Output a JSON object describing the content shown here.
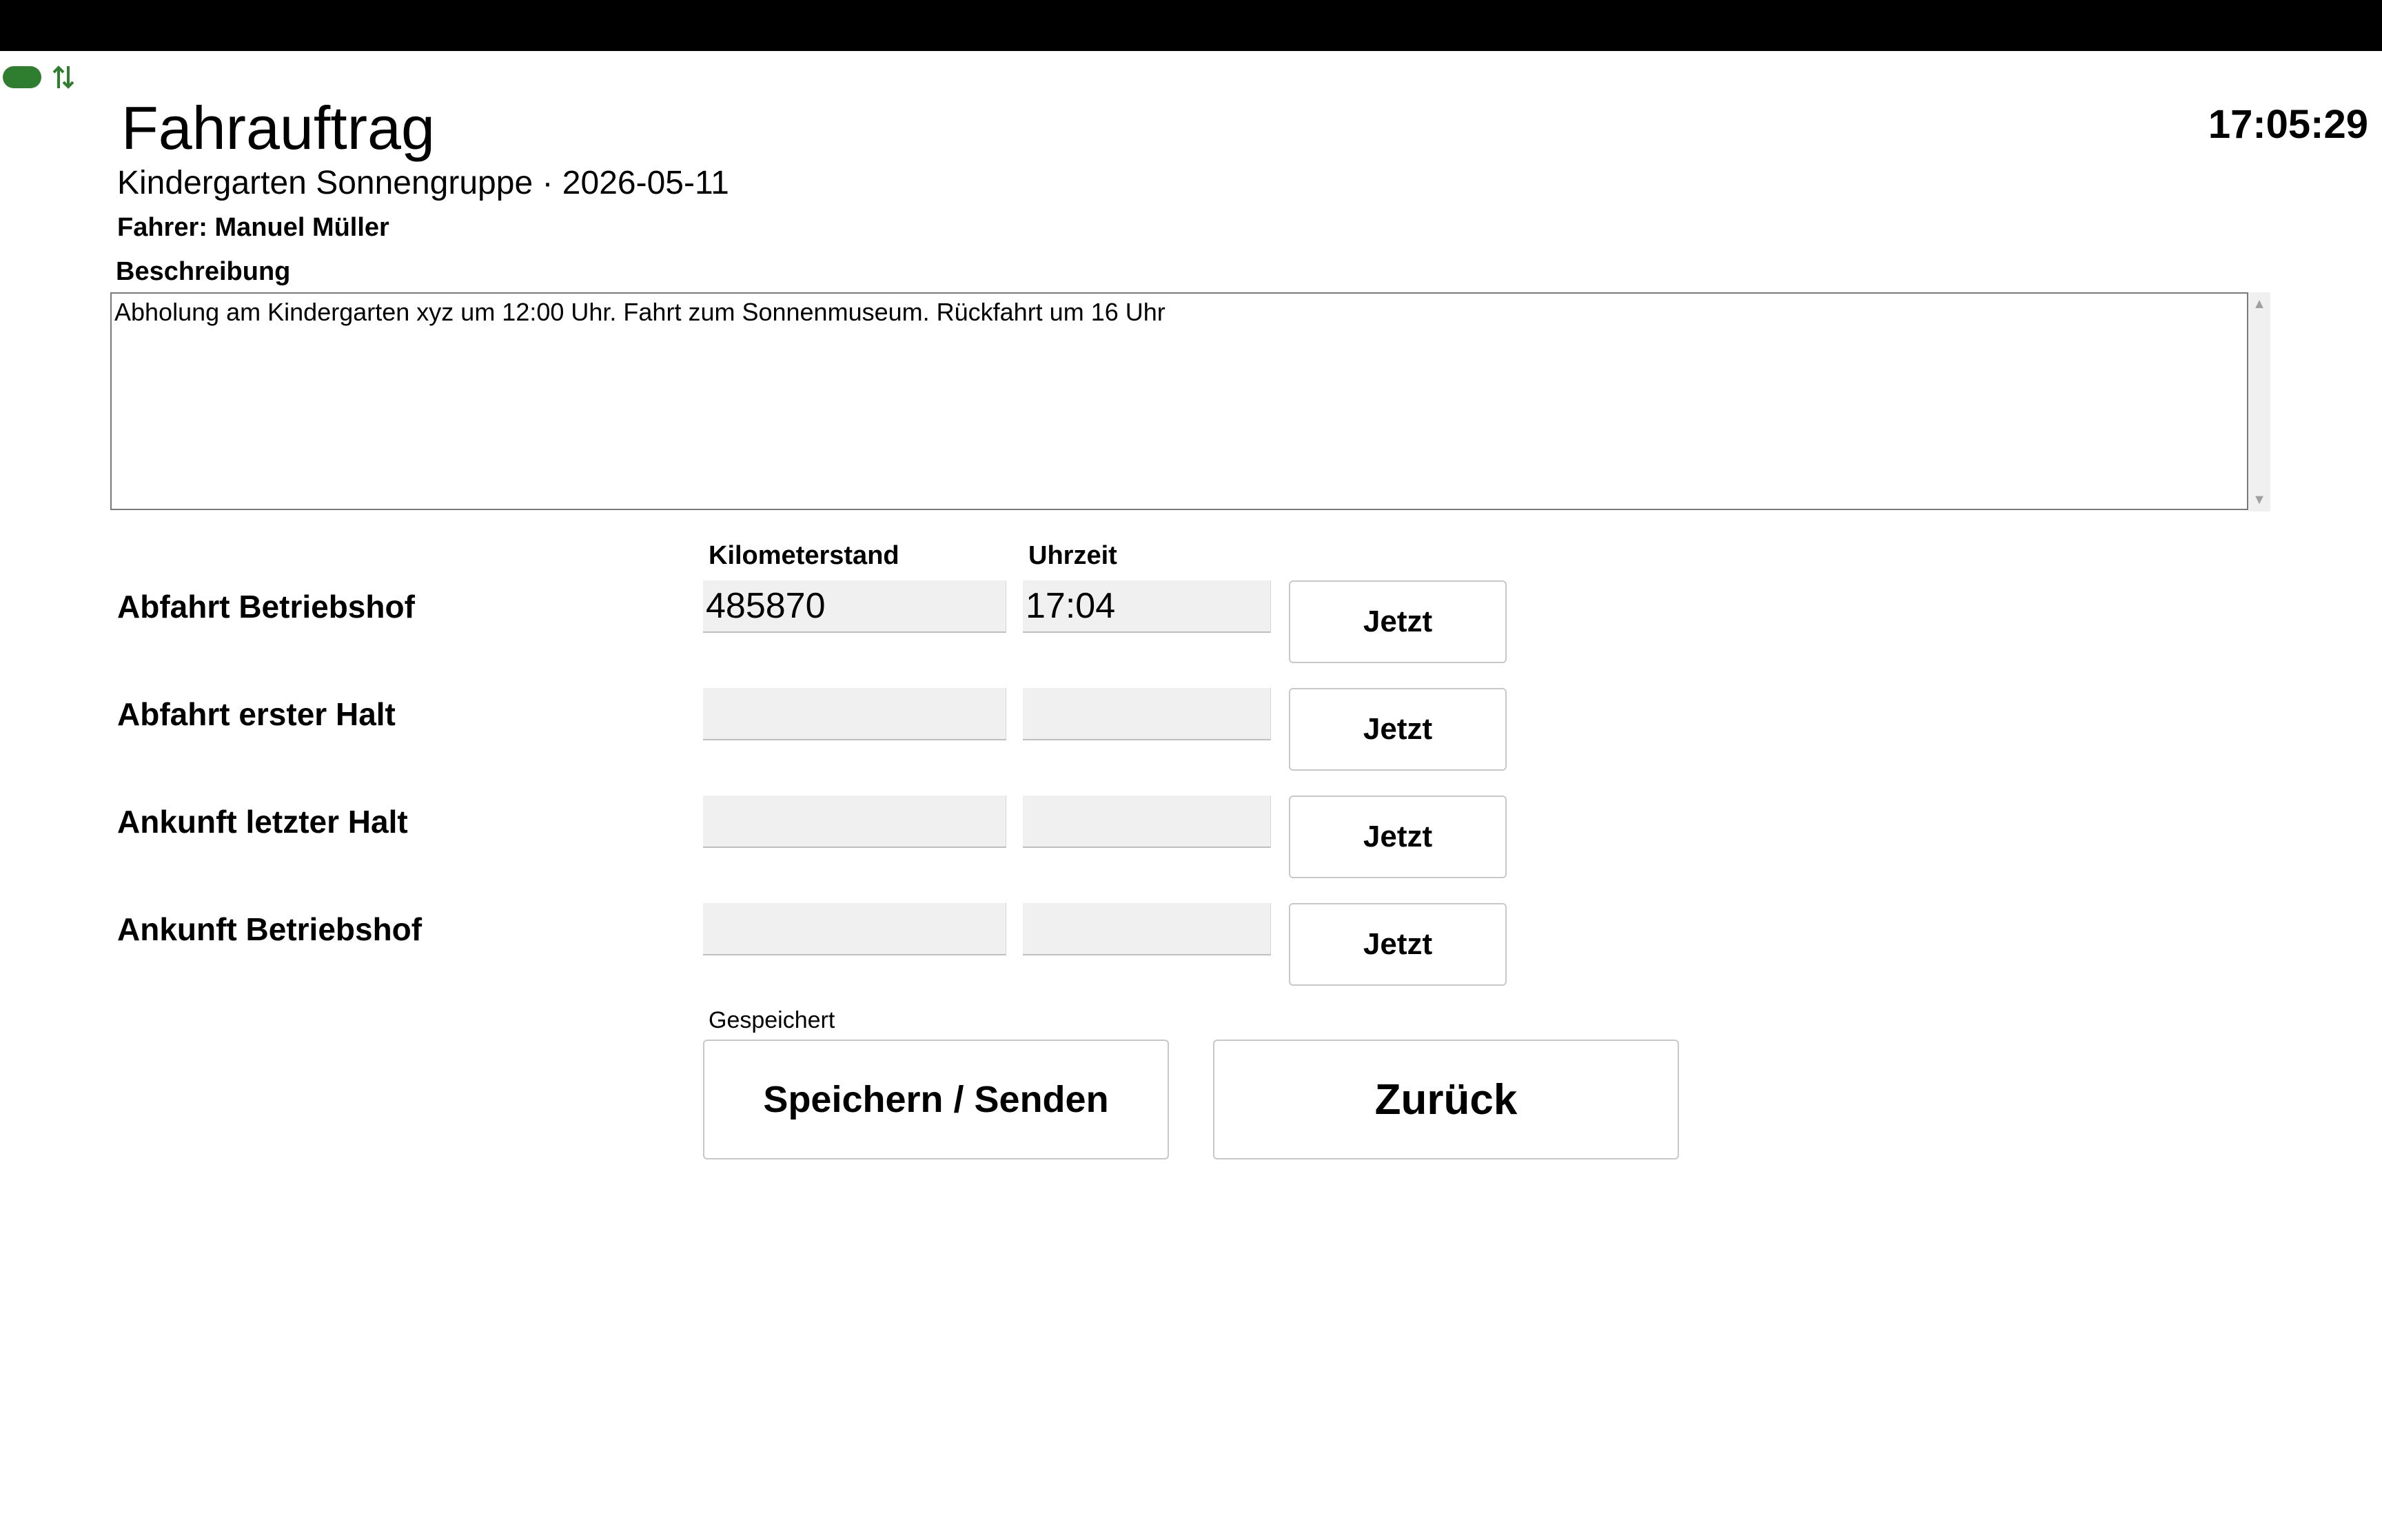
{
  "header": {
    "title": "Fahrauftrag",
    "clock": "17:05:29",
    "subtitle": "Kindergarten Sonnengruppe · 2026-05-11",
    "driver": "Fahrer: Manuel Müller",
    "status_icons": [
      "cloud-icon",
      "sync-arrows-icon"
    ],
    "status_color": "#2f7d2f"
  },
  "description": {
    "label": "Beschreibung",
    "value": "Abholung am Kindergarten xyz um 12:00 Uhr. Fahrt zum Sonnenmuseum. Rückfahrt um 16 Uhr"
  },
  "columns": {
    "km": "Kilometerstand",
    "time": "Uhrzeit"
  },
  "rows": [
    {
      "label": "Abfahrt Betriebshof",
      "km": "485870",
      "time": "17:04",
      "button": "Jetzt"
    },
    {
      "label": "Abfahrt erster Halt",
      "km": "",
      "time": "",
      "button": "Jetzt"
    },
    {
      "label": "Ankunft letzter Halt",
      "km": "",
      "time": "",
      "button": "Jetzt"
    },
    {
      "label": "Ankunft Betriebshof",
      "km": "",
      "time": "",
      "button": "Jetzt"
    }
  ],
  "footer": {
    "status": "Gespeichert",
    "save_label": "Speichern / Senden",
    "back_label": "Zurück"
  }
}
